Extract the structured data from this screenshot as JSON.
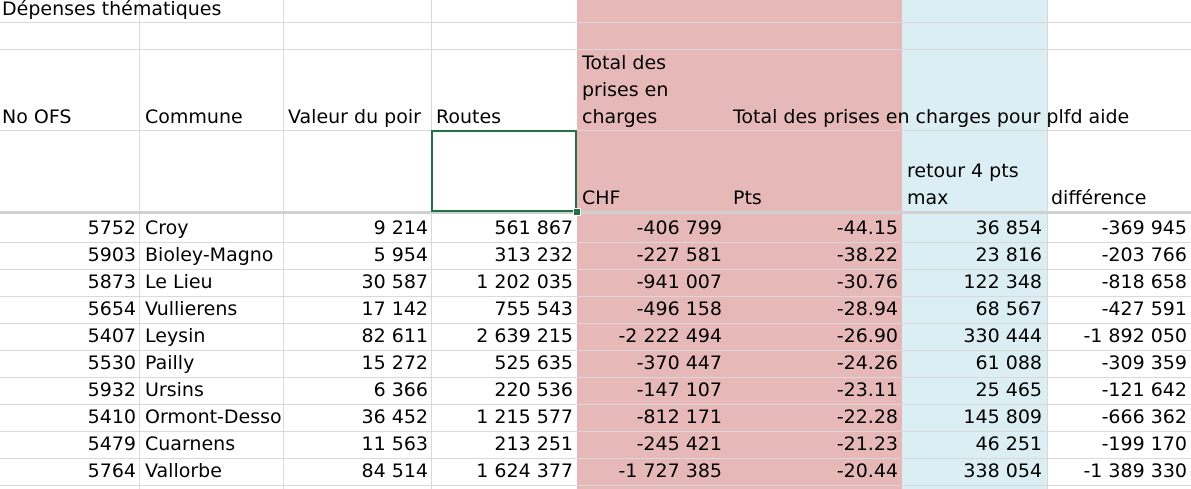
{
  "sheet": {
    "title": "Dépenses thématiques",
    "headers": {
      "no_ofs": "No OFS",
      "commune": "Commune",
      "valeur": "Valeur du poir",
      "routes": "Routes",
      "total_prises": "Total des prises en charges",
      "total_plfd": "Total des prises en charges pour plfd aide",
      "chf": "CHF",
      "pts": "Pts",
      "retour": "retour 4 pts max",
      "difference": "différence"
    },
    "rows": [
      {
        "ofs": "5752",
        "commune": "Croy",
        "valeur": "9 214",
        "routes": "561 867",
        "chf": "-406 799",
        "pts": "-44.15",
        "retour": "36 854",
        "diff": "-369 945"
      },
      {
        "ofs": "5903",
        "commune": "Bioley-Magno",
        "valeur": "5 954",
        "routes": "313 232",
        "chf": "-227 581",
        "pts": "-38.22",
        "retour": "23 816",
        "diff": "-203 766"
      },
      {
        "ofs": "5873",
        "commune": "Le Lieu",
        "valeur": "30 587",
        "routes": "1 202 035",
        "chf": "-941 007",
        "pts": "-30.76",
        "retour": "122 348",
        "diff": "-818 658"
      },
      {
        "ofs": "5654",
        "commune": "Vullierens",
        "valeur": "17 142",
        "routes": "755 543",
        "chf": "-496 158",
        "pts": "-28.94",
        "retour": "68 567",
        "diff": "-427 591"
      },
      {
        "ofs": "5407",
        "commune": "Leysin",
        "valeur": "82 611",
        "routes": "2 639 215",
        "chf": "-2 222 494",
        "pts": "-26.90",
        "retour": "330 444",
        "diff": "-1 892 050"
      },
      {
        "ofs": "5530",
        "commune": "Pailly",
        "valeur": "15 272",
        "routes": "525 635",
        "chf": "-370 447",
        "pts": "-24.26",
        "retour": "61 088",
        "diff": "-309 359"
      },
      {
        "ofs": "5932",
        "commune": "Ursins",
        "valeur": "6 366",
        "routes": "220 536",
        "chf": "-147 107",
        "pts": "-23.11",
        "retour": "25 465",
        "diff": "-121 642"
      },
      {
        "ofs": "5410",
        "commune": "Ormont-Desso",
        "valeur": "36 452",
        "routes": "1 215 577",
        "chf": "-812 171",
        "pts": "-22.28",
        "retour": "145 809",
        "diff": "-666 362"
      },
      {
        "ofs": "5479",
        "commune": "Cuarnens",
        "valeur": "11 563",
        "routes": "213 251",
        "chf": "-245 421",
        "pts": "-21.23",
        "retour": "46 251",
        "diff": "-199 170"
      },
      {
        "ofs": "5764",
        "commune": "Vallorbe",
        "valeur": "84 514",
        "routes": "1 624 377",
        "chf": "-1 727 385",
        "pts": "-20.44",
        "retour": "338 054",
        "diff": "-1 389 330"
      }
    ]
  }
}
